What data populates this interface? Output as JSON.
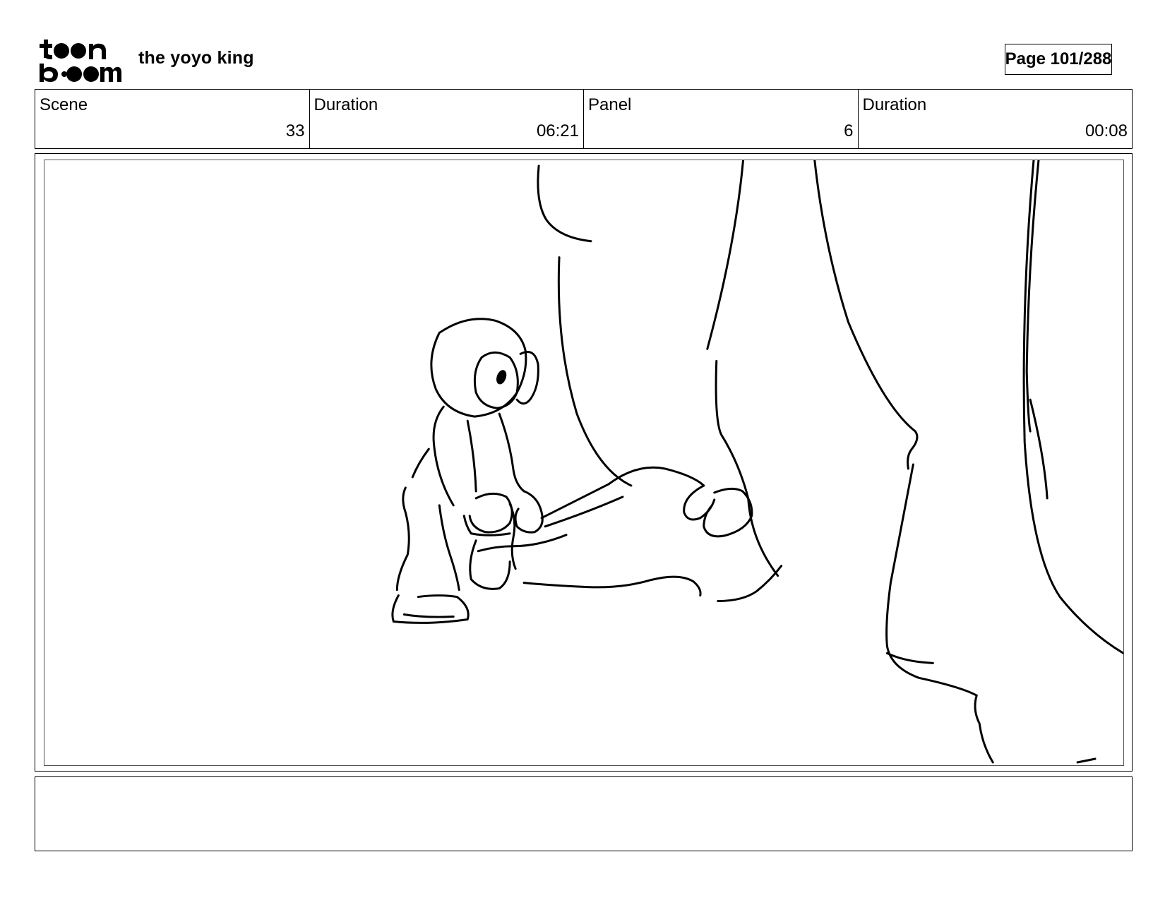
{
  "header": {
    "logo_text": "toon boom",
    "project_title": "the yoyo king",
    "page_label": "Page 101/288"
  },
  "info": {
    "scene_label": "Scene",
    "scene_value": "33",
    "scene_duration_label": "Duration",
    "scene_duration_value": "06:21",
    "panel_label": "Panel",
    "panel_value": "6",
    "panel_duration_label": "Duration",
    "panel_duration_value": "00:08"
  },
  "notes": {
    "text": ""
  }
}
